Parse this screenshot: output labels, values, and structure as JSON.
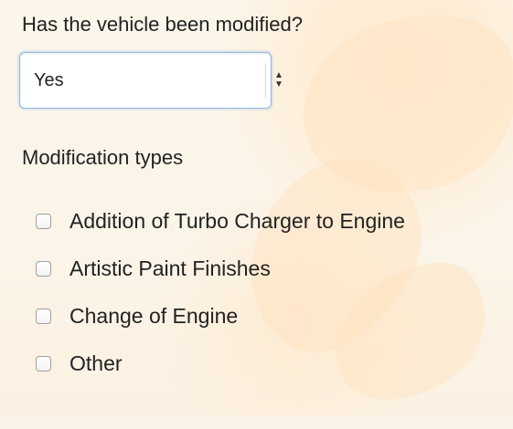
{
  "form": {
    "question": "Has the vehicle been modified?",
    "select": {
      "value": "Yes"
    },
    "modification_types": {
      "label": "Modification types",
      "options": [
        {
          "label": "Addition of Turbo Charger to Engine"
        },
        {
          "label": "Artistic Paint Finishes"
        },
        {
          "label": "Change of Engine"
        },
        {
          "label": "Other"
        }
      ]
    }
  },
  "colors": {
    "background": "#fbf3e7",
    "accent": "#8fb6e8",
    "text": "#222222"
  },
  "icons": {
    "select_arrow": "chevron-up-down-icon",
    "checkbox": "checkbox-icon"
  }
}
